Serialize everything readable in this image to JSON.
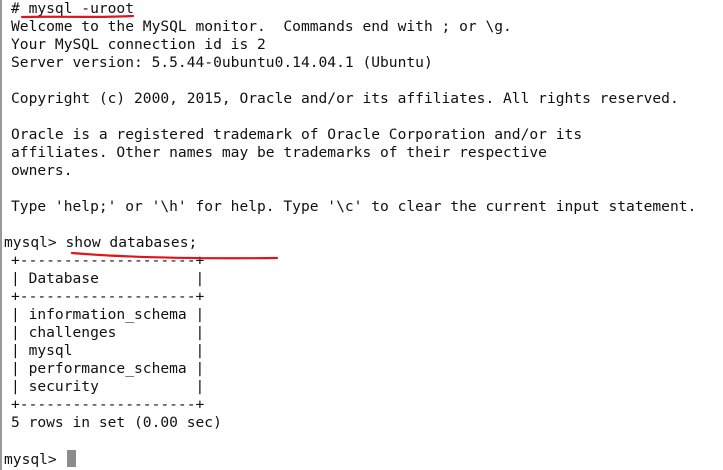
{
  "terminal": {
    "lines": [
      "# mysql -uroot",
      "Welcome to the MySQL monitor.  Commands end with ; or \\g.",
      "Your MySQL connection id is 2",
      "Server version: 5.5.44-0ubuntu0.14.04.1 (Ubuntu)",
      "",
      "Copyright (c) 2000, 2015, Oracle and/or its affiliates. All rights reserved.",
      "",
      "Oracle is a registered trademark of Oracle Corporation and/or its",
      "affiliates. Other names may be trademarks of their respective",
      "owners.",
      "",
      "Type 'help;' or '\\h' for help. Type '\\c' to clear the current input statement.",
      "",
      "mysql> show databases;",
      "+--------------------+",
      "| Database           |",
      "+--------------------+",
      "| information_schema |",
      "| challenges         |",
      "| mysql              |",
      "| performance_schema |",
      "| security           |",
      "+--------------------+",
      "5 rows in set (0.00 sec)",
      ""
    ],
    "prompt": "mysql> ",
    "annotation_color": "#e0141e",
    "text_color": "#111111",
    "background_color": "#ffffff"
  }
}
